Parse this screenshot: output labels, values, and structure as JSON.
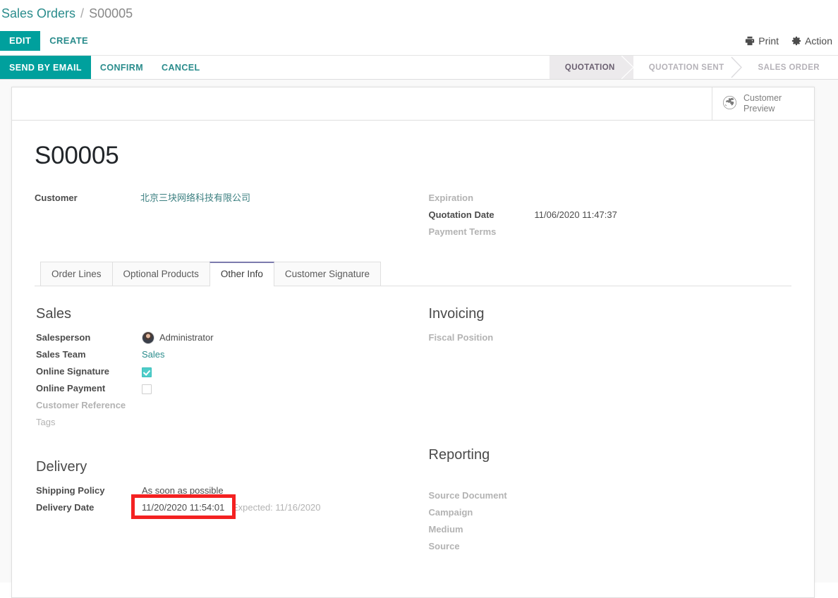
{
  "breadcrumb": {
    "root": "Sales Orders",
    "separator": "/",
    "current": "S00005"
  },
  "control_panel": {
    "edit_label": "EDIT",
    "create_label": "CREATE",
    "print_label": "Print",
    "action_label": "Action",
    "print_icon": "printer-icon",
    "action_icon": "gear-icon"
  },
  "statusbar": {
    "buttons": [
      {
        "label": "SEND BY EMAIL",
        "primary": true
      },
      {
        "label": "CONFIRM",
        "primary": false
      },
      {
        "label": "CANCEL",
        "primary": false
      }
    ],
    "stages": [
      {
        "label": "QUOTATION",
        "active": true
      },
      {
        "label": "QUOTATION SENT",
        "active": false
      },
      {
        "label": "SALES ORDER",
        "active": false
      }
    ]
  },
  "stat_button": {
    "icon": "globe-icon",
    "line1": "Customer",
    "line2": "Preview"
  },
  "record": {
    "title": "S00005",
    "left_fields": [
      {
        "label": "Customer",
        "value": "北京三块网络科技有限公司",
        "style": "chinese"
      }
    ],
    "right_fields": [
      {
        "label": "Expiration",
        "value": "",
        "label_style": "muted"
      },
      {
        "label": "Quotation Date",
        "value": "11/06/2020 11:47:37",
        "label_style": "normal"
      },
      {
        "label": "Payment Terms",
        "value": "",
        "label_style": "muted"
      }
    ]
  },
  "tabs": [
    {
      "label": "Order Lines",
      "active": false
    },
    {
      "label": "Optional Products",
      "active": false
    },
    {
      "label": "Other Info",
      "active": true
    },
    {
      "label": "Customer Signature",
      "active": false
    }
  ],
  "other_info": {
    "sales": {
      "title": "Sales",
      "salesperson_label": "Salesperson",
      "salesperson_value": "Administrator",
      "salesperson_avatar": "user-avatar",
      "sales_team_label": "Sales Team",
      "sales_team_value": "Sales",
      "online_signature_label": "Online Signature",
      "online_signature_checked": true,
      "online_payment_label": "Online Payment",
      "online_payment_checked": false,
      "customer_reference_label": "Customer Reference",
      "customer_reference_value": "",
      "tags_label": "Tags",
      "tags_value": ""
    },
    "invoicing": {
      "title": "Invoicing",
      "fiscal_position_label": "Fiscal Position",
      "fiscal_position_value": ""
    },
    "delivery": {
      "title": "Delivery",
      "shipping_policy_label": "Shipping Policy",
      "shipping_policy_value": "As soon as possible",
      "delivery_date_label": "Delivery Date",
      "delivery_date_value": "11/20/2020 11:54:01",
      "delivery_date_expected": "Expected: 11/16/2020",
      "highlight_color": "#f42121"
    },
    "reporting": {
      "title": "Reporting",
      "source_document_label": "Source Document",
      "source_document_value": "",
      "campaign_label": "Campaign",
      "campaign_value": "",
      "medium_label": "Medium",
      "medium_value": "",
      "source_label": "Source",
      "source_value": ""
    }
  },
  "theme": {
    "primary": "#00a09d",
    "link": "#2a8c8c",
    "tab_accent": "#7c7bad",
    "muted": "#b3b3b3"
  }
}
